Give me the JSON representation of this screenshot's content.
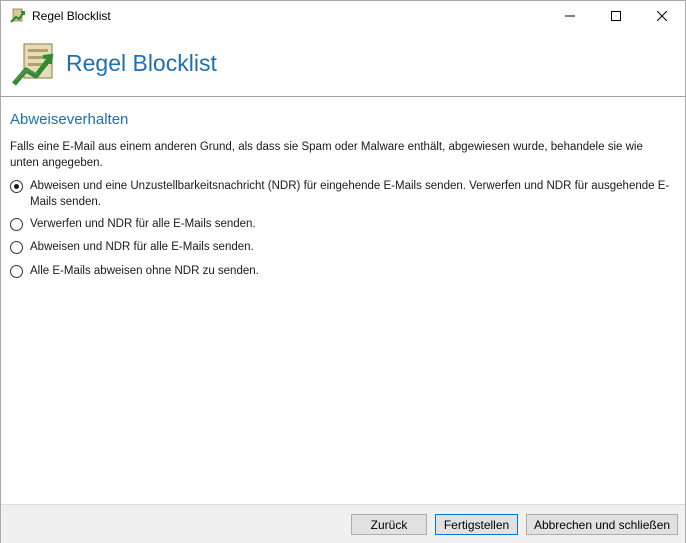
{
  "window": {
    "title": "Regel Blocklist"
  },
  "header": {
    "title": "Regel Blocklist"
  },
  "section": {
    "title": "Abweiseverhalten",
    "description": "Falls eine E-Mail aus einem anderen Grund, als dass sie Spam oder Malware enthält, abgewiesen wurde, behandele sie wie unten angegeben."
  },
  "options": [
    {
      "label": "Abweisen und eine Unzustellbarkeitsnachricht (NDR) für eingehende E-Mails senden. Verwerfen und NDR für ausgehende E-Mails senden.",
      "selected": true
    },
    {
      "label": "Verwerfen und NDR für alle E-Mails senden.",
      "selected": false
    },
    {
      "label": "Abweisen und NDR für alle E-Mails senden.",
      "selected": false
    },
    {
      "label": "Alle E-Mails abweisen ohne NDR zu senden.",
      "selected": false
    }
  ],
  "footer": {
    "back_label": "Zurück",
    "finish_label": "Fertigstellen",
    "cancel_label": "Abbrechen und schließen"
  }
}
